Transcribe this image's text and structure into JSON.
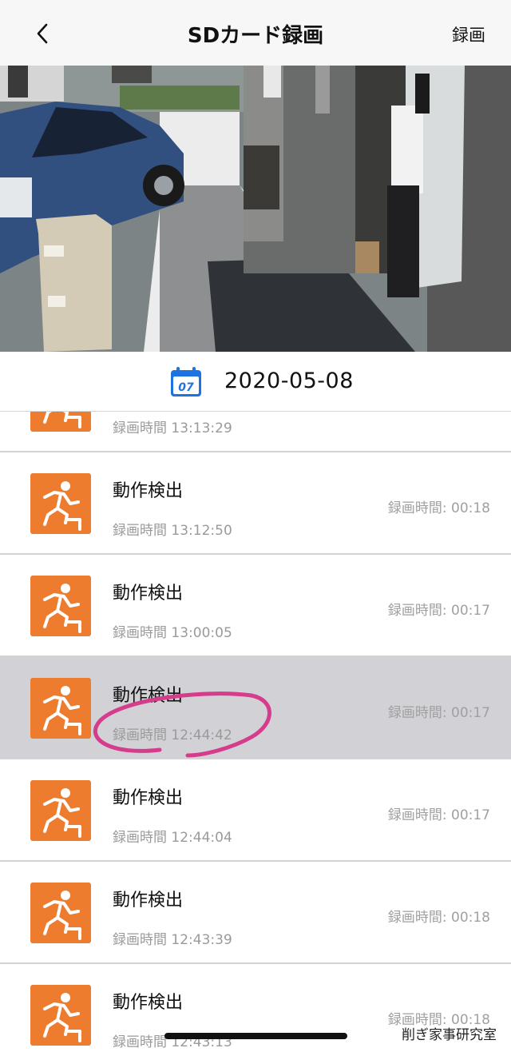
{
  "header": {
    "back_icon": "chevron-left-icon",
    "title": "SDカード録画",
    "action_label": "録画"
  },
  "camera": {
    "description_icon": "camera-feed"
  },
  "datebar": {
    "calendar_icon": "calendar-icon",
    "calendar_day": "07",
    "date": "2020-05-08"
  },
  "records": [
    {
      "title": "",
      "time": "録画時間 13:13:29",
      "duration": ""
    },
    {
      "title": "動作検出",
      "time": "録画時間 13:12:50",
      "duration": "録画時間: 00:18"
    },
    {
      "title": "動作検出",
      "time": "録画時間 13:00:05",
      "duration": "録画時間: 00:17"
    },
    {
      "title": "動作検出",
      "time": "録画時間 12:44:42",
      "duration": "録画時間: 00:17"
    },
    {
      "title": "動作検出",
      "time": "録画時間 12:44:04",
      "duration": "録画時間: 00:17"
    },
    {
      "title": "動作検出",
      "time": "録画時間 12:43:39",
      "duration": "録画時間: 00:18"
    },
    {
      "title": "動作検出",
      "time": "録画時間 12:43:13",
      "duration": "録画時間: 00:18"
    }
  ],
  "thumb_icon": "motion-running-icon",
  "colors": {
    "accent": "#ee7c2e",
    "selected_row": "#d2d2d6",
    "annotation": "#d63c8c"
  },
  "watermark": "削ぎ家事研究室"
}
